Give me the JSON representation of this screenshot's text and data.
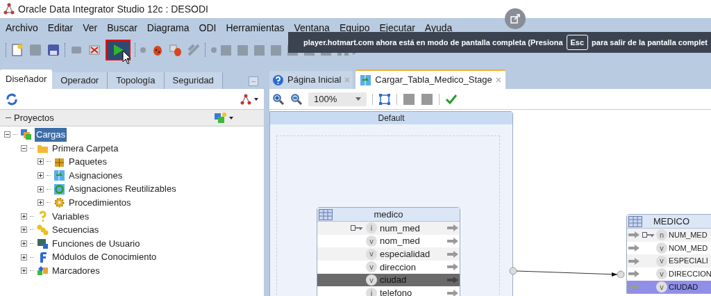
{
  "window": {
    "title": "Oracle Data Integrator Studio 12c : DESODI"
  },
  "menu": [
    "Archivo",
    "Editar",
    "Ver",
    "Buscar",
    "Diagrama",
    "ODI",
    "Herramientas",
    "Ventana",
    "Equipo",
    "Ejecutar",
    "Ayuda"
  ],
  "fullscreen_notice": {
    "before": "player.hotmart.com ahora está en modo de pantalla completa (Presiona",
    "key": "Esc",
    "after": "para salir de la pantalla complet"
  },
  "left_tabs": [
    {
      "label": "Diseñador",
      "selected": true
    },
    {
      "label": "Operador",
      "selected": false
    },
    {
      "label": "Topología",
      "selected": false
    },
    {
      "label": "Seguridad",
      "selected": false
    }
  ],
  "projects": {
    "title": "Proyectos",
    "tree": [
      {
        "label": "Cargas",
        "kind": "project",
        "expanded": true,
        "selected": true,
        "children": [
          {
            "label": "Primera Carpeta",
            "kind": "folder",
            "expanded": true,
            "selected": false,
            "children": [
              {
                "label": "Paquetes",
                "kind": "package",
                "expanded": false,
                "selected": false
              },
              {
                "label": "Asignaciones",
                "kind": "mapping",
                "expanded": false,
                "selected": false
              },
              {
                "label": "Asignaciones Reutilizables",
                "kind": "reusable",
                "expanded": false,
                "selected": false
              },
              {
                "label": "Procedimientos",
                "kind": "procedure",
                "expanded": false,
                "selected": false
              }
            ]
          },
          {
            "label": "Variables",
            "kind": "variable",
            "expanded": false,
            "selected": false
          },
          {
            "label": "Secuencias",
            "kind": "sequence",
            "expanded": false,
            "selected": false
          },
          {
            "label": "Funciones de Usuario",
            "kind": "function",
            "expanded": false,
            "selected": false
          },
          {
            "label": "Módulos de Conocimiento",
            "kind": "module",
            "expanded": false,
            "selected": false
          },
          {
            "label": "Marcadores",
            "kind": "marker",
            "expanded": false,
            "selected": false
          }
        ]
      }
    ]
  },
  "editor_tabs": [
    {
      "label": "Página Inicial",
      "selected": false
    },
    {
      "label": "Cargar_Tabla_Medico_Stage",
      "selected": true
    }
  ],
  "zoom": "100%",
  "diagram": {
    "group": "Default",
    "source": {
      "name": "medico",
      "columns": [
        {
          "name": "num_med",
          "type": "i",
          "key": true,
          "selected": false
        },
        {
          "name": "nom_med",
          "type": "v",
          "key": false,
          "selected": false
        },
        {
          "name": "especialidad",
          "type": "v",
          "key": false,
          "selected": false
        },
        {
          "name": "direccion",
          "type": "v",
          "key": false,
          "selected": false
        },
        {
          "name": "ciudad",
          "type": "v",
          "key": false,
          "selected": true
        },
        {
          "name": "telefono",
          "type": "i",
          "key": false,
          "selected": false
        }
      ]
    },
    "target": {
      "name": "MEDICO",
      "columns": [
        {
          "name": "NUM_MED",
          "type": "n",
          "key": true,
          "selected": false
        },
        {
          "name": "NOM_MED",
          "type": "v",
          "key": false,
          "selected": false
        },
        {
          "name": "ESPECIALI",
          "type": "v",
          "key": false,
          "selected": false
        },
        {
          "name": "DIRECCION",
          "type": "v",
          "key": false,
          "selected": false
        },
        {
          "name": "CIUDAD",
          "type": "v",
          "key": false,
          "selected": true
        }
      ]
    }
  }
}
